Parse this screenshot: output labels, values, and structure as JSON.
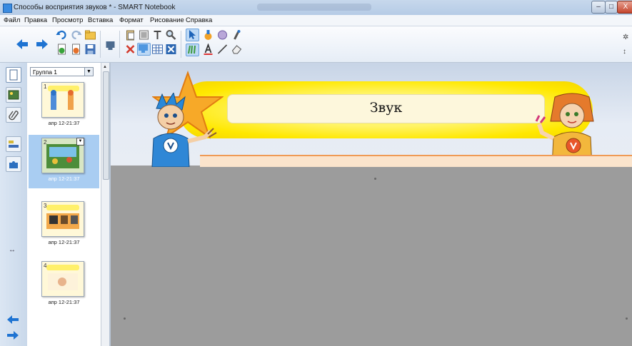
{
  "window": {
    "title": "Способы восприятия звуков * - SMART Notebook",
    "controls": {
      "minimize": "–",
      "maximize": "□",
      "close": "X"
    }
  },
  "menu": [
    "Файл",
    "Правка",
    "Просмотр",
    "Вставка",
    "Формат",
    "Рисование",
    "Справка"
  ],
  "sorter": {
    "group_selector": "Группа 1",
    "pages": [
      {
        "number": "1",
        "caption": "апр 12-21:37",
        "selected": false
      },
      {
        "number": "2",
        "caption": "апр 12-21:37",
        "selected": true
      },
      {
        "number": "3",
        "caption": "апр 12-21:37",
        "selected": false
      },
      {
        "number": "4",
        "caption": "апр 12-21:37",
        "selected": false
      }
    ]
  },
  "slide": {
    "title": "Звук"
  },
  "colors": {
    "banner_yellow": "#ffe800",
    "star_orange": "#f7a928",
    "selection_blue": "#a9cdf2",
    "canvas_gray": "#9c9c9c"
  },
  "icons": {
    "back": "arrow-left-icon",
    "forward": "arrow-right-icon",
    "undo": "undo-icon",
    "redo": "redo-icon",
    "delete": "delete-x-icon",
    "select": "cursor-icon",
    "pens": "pen-icon",
    "eraser": "eraser-icon",
    "line": "line-icon",
    "fill": "fill-icon"
  }
}
